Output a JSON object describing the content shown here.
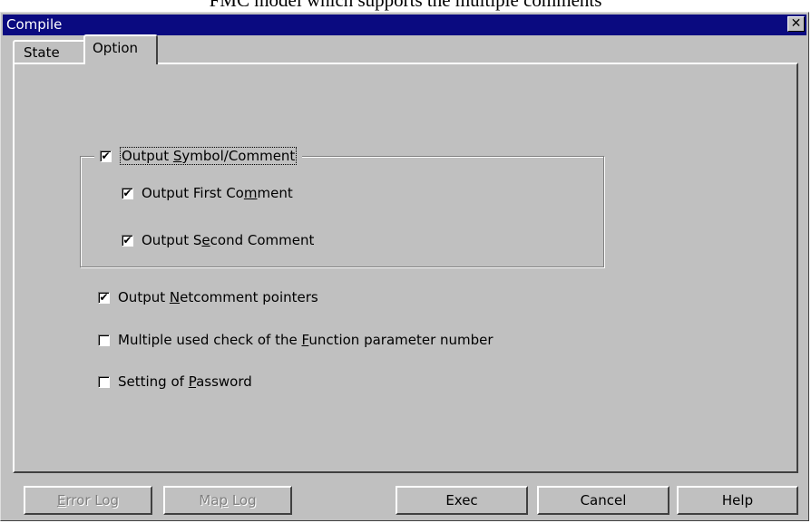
{
  "caption": "FMC model which supports the multiple comments",
  "window": {
    "title": "Compile",
    "close_glyph": "✕"
  },
  "tabs": [
    {
      "label": "State",
      "selected": false
    },
    {
      "label": "Option",
      "selected": true
    }
  ],
  "options": {
    "output_symbol_comment": {
      "pre": "Output ",
      "ul": "S",
      "post": "ymbol/Comment",
      "checked": true
    },
    "output_first_comment": {
      "pre": "Output First Co",
      "ul": "m",
      "post": "ment",
      "checked": true
    },
    "output_second_comment": {
      "pre": "Output S",
      "ul": "e",
      "post": "cond Comment",
      "checked": true
    },
    "output_netcomment_pointers": {
      "pre": "Output ",
      "ul": "N",
      "post": "etcomment pointers",
      "checked": true
    },
    "multiple_used_check": {
      "pre": "Multiple used check of the ",
      "ul": "F",
      "post": "unction parameter number",
      "checked": false
    },
    "setting_of_password": {
      "pre": "Setting of ",
      "ul": "P",
      "post": "assword",
      "checked": false
    }
  },
  "buttons": {
    "error_log": {
      "ul": "E",
      "post": "rror Log",
      "enabled": false
    },
    "map_log": {
      "pre": "Ma",
      "ul": "p",
      "post": " Log",
      "enabled": false
    },
    "exec": {
      "label": "Exec",
      "enabled": true
    },
    "cancel": {
      "label": "Cancel",
      "enabled": true
    },
    "help": {
      "label": "Help",
      "enabled": true
    }
  },
  "check_glyph": "✔"
}
